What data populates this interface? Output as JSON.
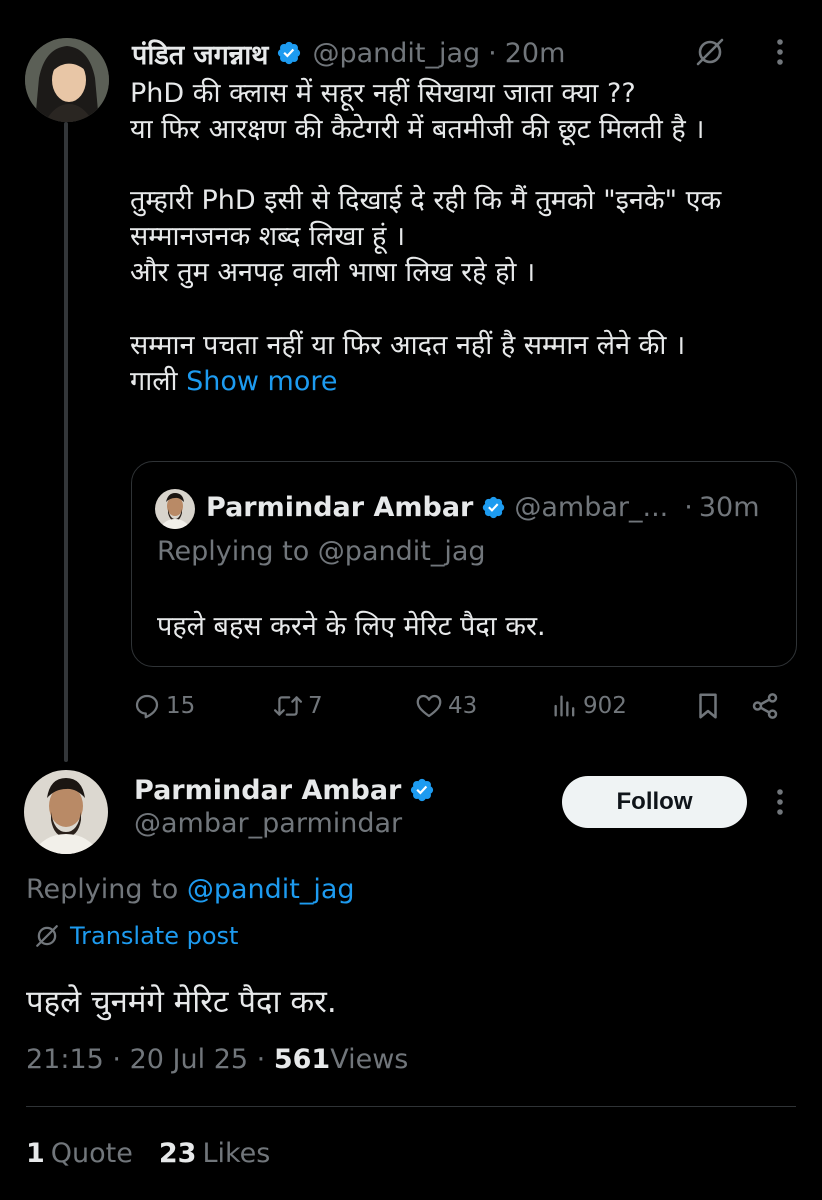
{
  "parent_tweet": {
    "author_name": "पंडित जगन्नाथ",
    "author_handle": "@pandit_jag",
    "separator": "·",
    "time": "20m",
    "body_lines": [
      "PhD की क्लास में सहूर नहीं सिखाया जाता क्या ??",
      "या फिर आरक्षण की कैटेगरी में बतमीजी की छूट मिलती है ।",
      "",
      "तुम्हारी PhD इसी से दिखाई दे रही कि मैं तुमको \"इनके\" एक",
      "सम्मानजनक शब्द लिखा हूं ।",
      "और तुम अनपढ़ वाली भाषा लिख रहे हो ।",
      "",
      "सम्मान पचता नहीं या फिर आदत नहीं है सम्मान लेने की ।"
    ],
    "last_line_prefix": "गाली",
    "show_more": "Show more",
    "quoted": {
      "author_name": "Parmindar Ambar",
      "author_handle": "@ambar_...",
      "separator": "·",
      "time": "30m",
      "replying_to": "Replying to @pandit_jag",
      "text": "पहले बहस करने के लिए मेरिट पैदा कर."
    },
    "actions": {
      "replies": "15",
      "reposts": "7",
      "likes": "43",
      "views": "902"
    }
  },
  "main_tweet": {
    "author_name": "Parmindar Ambar",
    "author_handle": "@ambar_parmindar",
    "follow_label": "Follow",
    "replying_prefix": "Replying to",
    "replying_handle": "@pandit_jag",
    "translate_label": "Translate post",
    "text": "पहले चुनमंगे मेरिट पैदा कर.",
    "time": "21:15",
    "separator": "·",
    "date": "20 Jul 25",
    "views_count": "561",
    "views_label": "Views",
    "quotes_count": "1",
    "quotes_label": "Quote",
    "likes_count": "23",
    "likes_label": "Likes"
  },
  "colors": {
    "background": "#000000",
    "text": "#e7e9ea",
    "muted": "#71767b",
    "accent": "#1d9bf0",
    "border": "#2f3336",
    "follow_bg": "#eff3f4"
  },
  "icons": [
    "verified-badge-icon",
    "translate-icon",
    "more-icon",
    "reply-icon",
    "repost-icon",
    "like-icon",
    "views-icon",
    "bookmark-icon",
    "share-icon"
  ]
}
